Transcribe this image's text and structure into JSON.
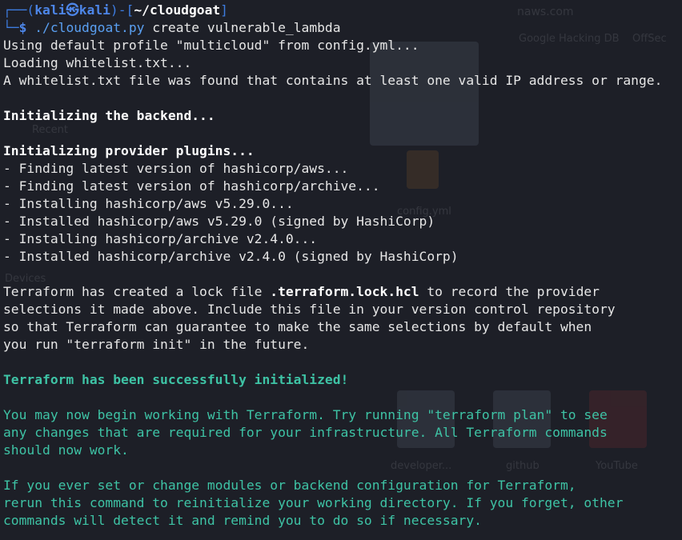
{
  "prompt": {
    "frame_top_left": "┌──(",
    "user_host": "kali㉿kali",
    "frame_mid": ")-[",
    "cwd": "~/cloudgoat",
    "frame_end": "]",
    "frame_bottom": "└─",
    "dollar": "$",
    "command": "./cloudgoat.py",
    "args": "create vulnerable_lambda"
  },
  "output": {
    "l1": "Using default profile \"multicloud\" from config.yml...",
    "l2": "Loading whitelist.txt...",
    "l3": "A whitelist.txt file was found that contains at least one valid IP address or range.",
    "l4": "Initializing the backend...",
    "l5": "Initializing provider plugins...",
    "l6": "- Finding latest version of hashicorp/aws...",
    "l7": "- Finding latest version of hashicorp/archive...",
    "l8": "- Installing hashicorp/aws v5.29.0...",
    "l9": "- Installed hashicorp/aws v5.29.0 (signed by HashiCorp)",
    "l10": "- Installing hashicorp/archive v2.4.0...",
    "l11": "- Installed hashicorp/archive v2.4.0 (signed by HashiCorp)",
    "l12a": "Terraform has created a lock file ",
    "l12b": ".terraform.lock.hcl",
    "l12c": " to record the provider",
    "l13": "selections it made above. Include this file in your version control repository",
    "l14": "so that Terraform can guarantee to make the same selections by default when",
    "l15": "you run \"terraform init\" in the future.",
    "l16": "Terraform has been successfully initialized!",
    "l17": "You may now begin working with Terraform. Try running \"terraform plan\" to see",
    "l18": "any changes that are required for your infrastructure. All Terraform commands",
    "l19": "should now work.",
    "l20": "If you ever set or change modules or backend configuration for Terraform,",
    "l21": "rerun this command to reinitialize your working directory. If you forget, other",
    "l22": "commands will detect it and remind you to do so if necessary."
  },
  "background": {
    "t1": "naws.com",
    "t2": "Google Hacking DB",
    "t3": "OffSec",
    "t4": "Recent",
    "t5": "Devices",
    "t6": "developer...",
    "t7": "github",
    "t8": "YouTube",
    "t9": "config.yml"
  },
  "colors": {
    "background": "#1d1f27",
    "prompt_blue": "#4d86e8",
    "success_green": "#3ec3a5",
    "text": "#e6e6e6"
  }
}
